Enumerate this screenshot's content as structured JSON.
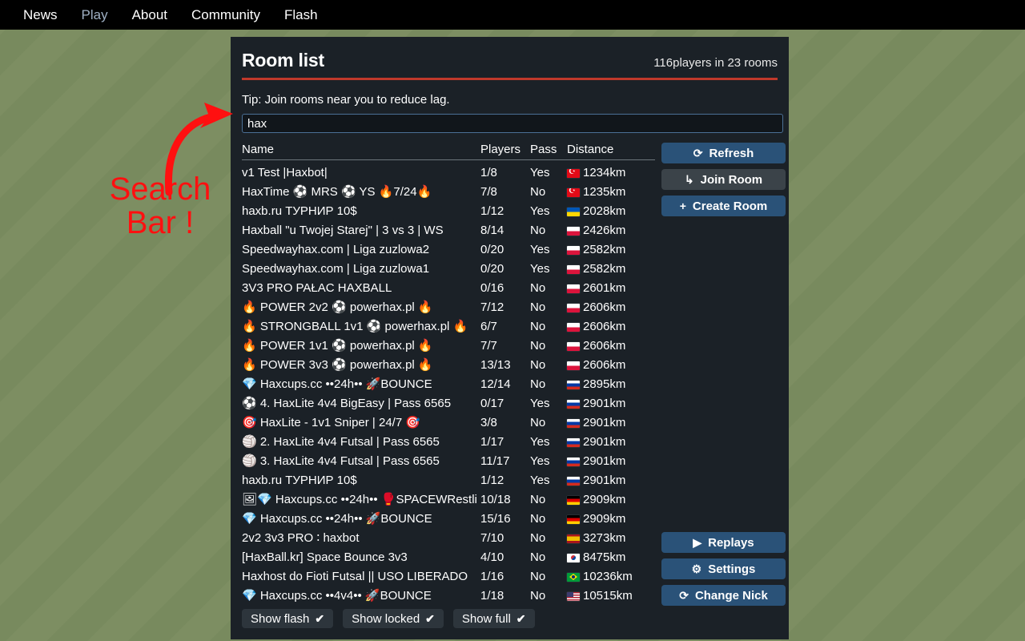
{
  "topnav": {
    "items": [
      {
        "label": "News",
        "active": false
      },
      {
        "label": "Play",
        "active": true
      },
      {
        "label": "About",
        "active": false
      },
      {
        "label": "Community",
        "active": false
      },
      {
        "label": "Flash",
        "active": false
      }
    ]
  },
  "annotation": {
    "line1": "Search",
    "line2": "Bar !",
    "color": "#ff1010"
  },
  "panel": {
    "title": "Room list",
    "count_text": "116players in 23 rooms",
    "tip": "Tip: Join rooms near you to reduce lag.",
    "accent_color": "#c0392b",
    "background": "#1b2127"
  },
  "search": {
    "value": "hax",
    "placeholder": ""
  },
  "table": {
    "headers": {
      "name": "Name",
      "players": "Players",
      "pass": "Pass",
      "distance": "Distance"
    },
    "rows": [
      {
        "prefix": "",
        "name": "v1 Test |Haxbot|",
        "players": "1/8",
        "pass": "Yes",
        "flag": "tr",
        "distance": "1234km"
      },
      {
        "prefix": "",
        "name": "HaxTime ⚽ MRS ⚽ YS 🔥7/24🔥",
        "players": "7/8",
        "pass": "No",
        "flag": "tr",
        "distance": "1235km"
      },
      {
        "prefix": "",
        "name": "haxb.ru ТУРНИР 10$",
        "players": "1/12",
        "pass": "Yes",
        "flag": "ua",
        "distance": "2028km"
      },
      {
        "prefix": "",
        "name": "Haxball \"u Twojej Starej\" | 3 vs 3 | WS",
        "players": "8/14",
        "pass": "No",
        "flag": "pl",
        "distance": "2426km"
      },
      {
        "prefix": "",
        "name": "Speedwayhax.com | Liga zuzlowa2",
        "players": "0/20",
        "pass": "Yes",
        "flag": "pl",
        "distance": "2582km"
      },
      {
        "prefix": "",
        "name": "Speedwayhax.com | Liga zuzlowa1",
        "players": "0/20",
        "pass": "Yes",
        "flag": "pl",
        "distance": "2582km"
      },
      {
        "prefix": "",
        "name": "3V3 PRO PAŁAC HAXBALL",
        "players": "0/16",
        "pass": "No",
        "flag": "pl",
        "distance": "2601km"
      },
      {
        "prefix": "🔥",
        "name": "POWER 2v2 ⚽ powerhax.pl 🔥",
        "players": "7/12",
        "pass": "No",
        "flag": "pl",
        "distance": "2606km"
      },
      {
        "prefix": "🔥",
        "name": "STRONGBALL 1v1 ⚽ powerhax.pl 🔥",
        "players": "6/7",
        "pass": "No",
        "flag": "pl",
        "distance": "2606km"
      },
      {
        "prefix": "🔥",
        "name": "POWER 1v1 ⚽ powerhax.pl 🔥",
        "players": "7/7",
        "pass": "No",
        "flag": "pl",
        "distance": "2606km"
      },
      {
        "prefix": "🔥",
        "name": "POWER 3v3 ⚽ powerhax.pl 🔥",
        "players": "13/13",
        "pass": "No",
        "flag": "pl",
        "distance": "2606km"
      },
      {
        "prefix": "💎",
        "name": "Haxcups.cc ••24h•• 🚀BOUNCE",
        "players": "12/14",
        "pass": "No",
        "flag": "ru",
        "distance": "2895km"
      },
      {
        "prefix": "⚽",
        "name": "4. HaxLite 4v4 BigEasy | Pass 6565",
        "players": "0/17",
        "pass": "Yes",
        "flag": "ru",
        "distance": "2901km"
      },
      {
        "prefix": "🎯",
        "name": "HaxLite - 1v1 Sniper | 24/7 🎯",
        "players": "3/8",
        "pass": "No",
        "flag": "ru",
        "distance": "2901km"
      },
      {
        "prefix": "🏐",
        "name": "2. HaxLite 4v4 Futsal | Pass 6565",
        "players": "1/17",
        "pass": "Yes",
        "flag": "ru",
        "distance": "2901km"
      },
      {
        "prefix": "🏐",
        "name": "3. HaxLite 4v4 Futsal | Pass 6565",
        "players": "11/17",
        "pass": "Yes",
        "flag": "ru",
        "distance": "2901km"
      },
      {
        "prefix": "",
        "name": "haxb.ru ТУРНИР 10$",
        "players": "1/12",
        "pass": "Yes",
        "flag": "ru",
        "distance": "2901km"
      },
      {
        "prefix": "🖼💎",
        "name": "Haxcups.cc ••24h•• 🥊SPACEWRestli",
        "players": "10/18",
        "pass": "No",
        "flag": "de",
        "distance": "2909km"
      },
      {
        "prefix": "💎",
        "name": "Haxcups.cc ••24h•• 🚀BOUNCE",
        "players": "15/16",
        "pass": "No",
        "flag": "de",
        "distance": "2909km"
      },
      {
        "prefix": "",
        "name": "2v2 3v3 PRO ∶ haxbot",
        "players": "7/10",
        "pass": "No",
        "flag": "es",
        "distance": "3273km"
      },
      {
        "prefix": "",
        "name": "[HaxBall.kr] Space Bounce 3v3",
        "players": "4/10",
        "pass": "No",
        "flag": "kr",
        "distance": "8475km"
      },
      {
        "prefix": "",
        "name": "Haxhost do Fioti Futsal || USO LIBERADO",
        "players": "1/16",
        "pass": "No",
        "flag": "br",
        "distance": "10236km"
      },
      {
        "prefix": "💎",
        "name": "Haxcups.cc ••4v4•• 🚀BOUNCE",
        "players": "1/18",
        "pass": "No",
        "flag": "us",
        "distance": "10515km"
      }
    ]
  },
  "actions": {
    "refresh": {
      "label": "Refresh",
      "icon": "refresh-icon",
      "glyph": "⟳"
    },
    "join_room": {
      "label": "Join Room",
      "icon": "enter-icon",
      "glyph": "↳"
    },
    "create_room": {
      "label": "Create Room",
      "icon": "plus-icon",
      "glyph": "+"
    },
    "replays": {
      "label": "Replays",
      "icon": "play-icon",
      "glyph": "▶"
    },
    "settings": {
      "label": "Settings",
      "icon": "gear-icon",
      "glyph": "⚙"
    },
    "change_nick": {
      "label": "Change Nick",
      "icon": "refresh-icon",
      "glyph": "⟳"
    }
  },
  "filters": [
    {
      "label": "Show flash",
      "checked": true,
      "glyph": "✔"
    },
    {
      "label": "Show locked",
      "checked": true,
      "glyph": "✔"
    },
    {
      "label": "Show full",
      "checked": true,
      "glyph": "✔"
    }
  ]
}
